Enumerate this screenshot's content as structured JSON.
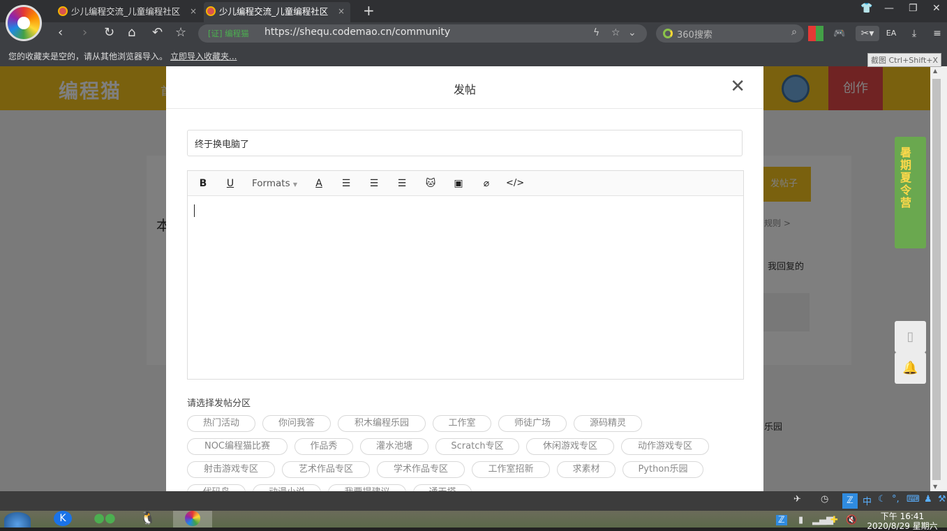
{
  "browser": {
    "tabs": [
      {
        "title": "少儿编程交流_儿童编程社区",
        "close": "×"
      },
      {
        "title": "少儿编程交流_儿童编程社区",
        "close": "×"
      }
    ],
    "new_tab": "+",
    "address": {
      "secure_label": "[证] 编程猫",
      "url": "https://shequ.codemao.cn/community"
    },
    "search_placeholder": "360搜索",
    "bookmarks_message": "您的收藏夹是空的，请从其他浏览器导入。",
    "bookmarks_import_link": "立即导入收藏夹...",
    "screenshot_tooltip": "截图 Ctrl+Shift+X"
  },
  "site": {
    "logo": "编程猫",
    "create_button": "创作",
    "nav_peek": "首",
    "background_texts": {
      "post_button": "发帖子",
      "rules_link": "规则 >",
      "reply_tab": "我回复的",
      "section_left": "本",
      "python_park": "乐园"
    },
    "ad_text": "暑期夏令营"
  },
  "modal": {
    "title": "发帖",
    "close": "✕",
    "title_input_value": "终于换电脑了",
    "toolbar": {
      "bold": "B",
      "underline": "U",
      "formats": "Formats",
      "font_color": "A"
    },
    "category_label": "请选择发帖分区",
    "categories": [
      "热门活动",
      "你问我答",
      "积木编程乐园",
      "工作室",
      "师徒广场",
      "源码精灵",
      "NOC编程猫比赛",
      "作品秀",
      "灌水池塘",
      "Scratch专区",
      "休闲游戏专区",
      "动作游戏专区",
      "射击游戏专区",
      "艺术作品专区",
      "学术作品专区",
      "工作室招新",
      "求素材",
      "Python乐园",
      "代码岛",
      "动漫小说",
      "我要提建议",
      "通天塔"
    ]
  },
  "taskbar": {
    "ime_label": "中",
    "clock_time": "下午 16:41",
    "clock_date": "2020/8/29 星期六"
  }
}
